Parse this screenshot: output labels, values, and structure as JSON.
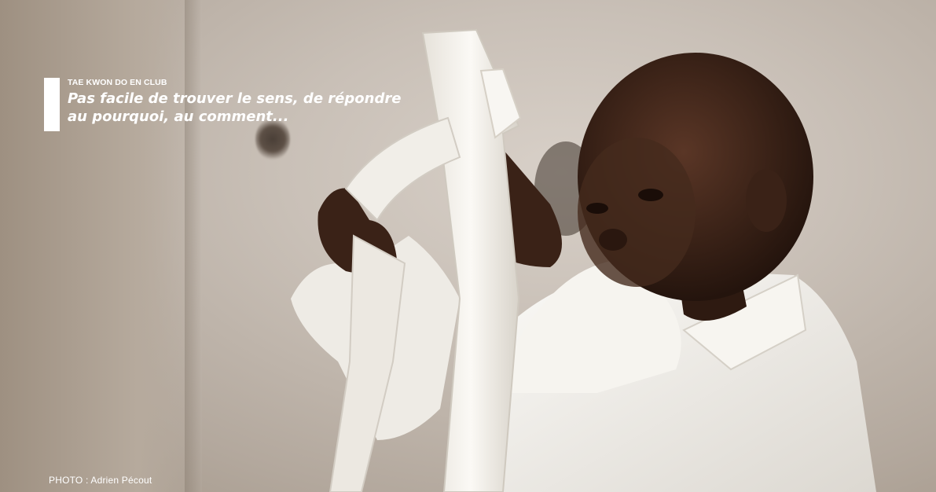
{
  "caption": {
    "kicker": "TAE KWON DO EN CLUB",
    "headline": "Pas facile de trouver le sens, de répondre au pourquoi, au comment..."
  },
  "photo": {
    "credit": "PHOTO : Adrien Pécout"
  },
  "colors": {
    "text": "#ffffff",
    "background": "#c4bab0",
    "skin": "#3a2418",
    "uniform": "#f4f1ec"
  }
}
